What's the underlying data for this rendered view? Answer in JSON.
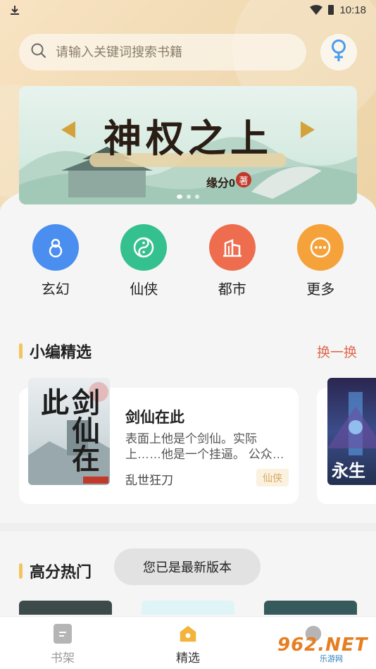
{
  "status_bar": {
    "time": "10:18"
  },
  "search": {
    "placeholder": "请输入关键词搜索书籍"
  },
  "banner": {
    "title": "神权之上",
    "author": "缘分0",
    "author_badge": "著"
  },
  "categories": [
    {
      "label": "玄幻",
      "color": "#4a8ef0",
      "icon": "gourd-icon"
    },
    {
      "label": "仙侠",
      "color": "#35c08f",
      "icon": "taiji-icon"
    },
    {
      "label": "都市",
      "color": "#ef6d4f",
      "icon": "building-icon"
    },
    {
      "label": "更多",
      "color": "#f5a23a",
      "icon": "more-icon"
    }
  ],
  "editor_pick": {
    "title": "小编精选",
    "swap_label": "换一换",
    "book": {
      "name": "剑仙在此",
      "cover_text": "剑仙在此",
      "desc": "表面上他是个剑仙。实际上……他是一个挂逼。 公众…",
      "author": "乱世狂刀",
      "tag": "仙侠"
    },
    "next_cover_text": "永生"
  },
  "high_score": {
    "title": "高分热门"
  },
  "toast": "您已是最新版本",
  "tabbar": [
    {
      "label": "书架",
      "active": false
    },
    {
      "label": "精选",
      "active": true
    }
  ],
  "watermark": {
    "main": "962.NET",
    "sub": "乐游网"
  },
  "colors": {
    "accent": "#f2c65c",
    "swap": "#e0694d",
    "tab_active": "#f2b43a"
  }
}
